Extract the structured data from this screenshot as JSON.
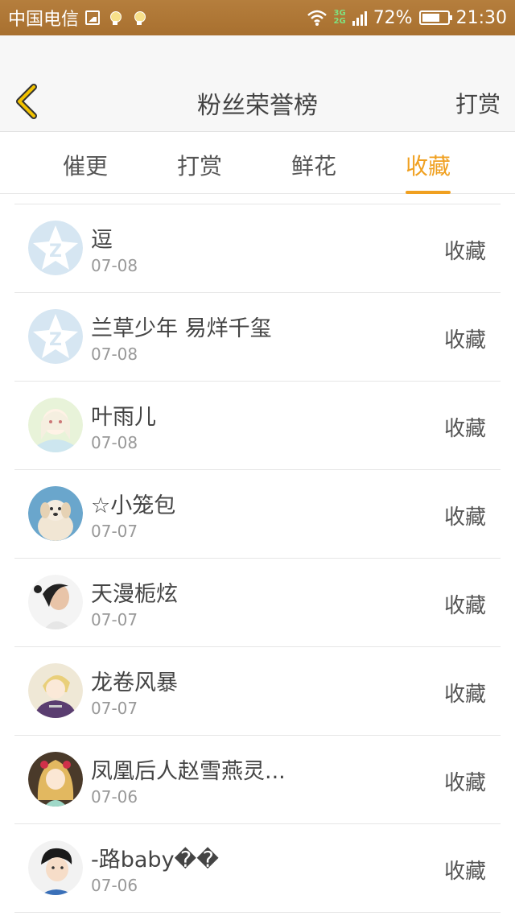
{
  "status_bar": {
    "carrier": "中国电信",
    "net_top": "3G",
    "net_bottom": "2G",
    "battery": "72%",
    "battery_level": 0.72,
    "time": "21:30"
  },
  "header": {
    "title": "粉丝荣誉榜",
    "right_action": "打赏"
  },
  "tabs": [
    {
      "label": "催更",
      "active": false
    },
    {
      "label": "打赏",
      "active": false
    },
    {
      "label": "鲜花",
      "active": false
    },
    {
      "label": "收藏",
      "active": true
    }
  ],
  "list": [
    {
      "name": "逗",
      "date": "07-08",
      "action": "收藏",
      "avatar": "default-q-avatar"
    },
    {
      "name": "兰草少年 易烊千玺",
      "date": "07-08",
      "action": "收藏",
      "avatar": "default-q-avatar"
    },
    {
      "name": "叶雨儿",
      "date": "07-08",
      "action": "收藏",
      "avatar": "anime-girl-avatar"
    },
    {
      "name": "☆小笼包",
      "date": "07-07",
      "action": "收藏",
      "avatar": "puppy-avatar"
    },
    {
      "name": "天漫栀炫",
      "date": "07-07",
      "action": "收藏",
      "avatar": "woman-portrait-avatar"
    },
    {
      "name": "龙卷风暴",
      "date": "07-07",
      "action": "收藏",
      "avatar": "anime-boy-avatar"
    },
    {
      "name": "凤凰后人赵雪燕灵...",
      "date": "07-06",
      "action": "收藏",
      "avatar": "anime-girl-red-avatar"
    },
    {
      "name": "-路baby��",
      "date": "07-06",
      "action": "收藏",
      "avatar": "boy-portrait-avatar"
    }
  ],
  "colors": {
    "status_bar": "#a8702f",
    "accent": "#f0a020",
    "back_arrow": "#f2c200"
  }
}
